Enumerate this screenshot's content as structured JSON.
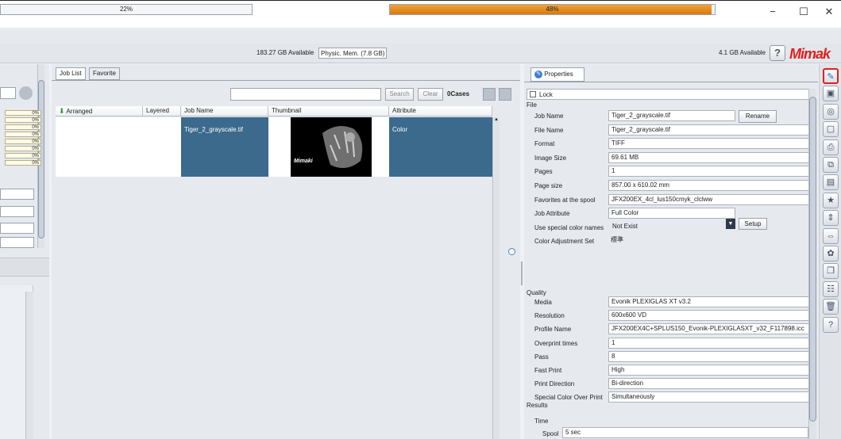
{
  "window": {
    "minimize": "−",
    "maximize": "☐",
    "close": "✕"
  },
  "status": {
    "disk_percent": "22%",
    "disk_available": "183.27 GB Available",
    "mem_label": "Physic. Mem. (7.8 GB)",
    "mem_percent": "48%",
    "mem_fill": 0.99,
    "mem_available": "4.1 GB Available",
    "help": "?",
    "logo": "Mimak"
  },
  "left_panel": {
    "percents": [
      "0%",
      "0%",
      "0%",
      "0%",
      "0%",
      "0%",
      "0%",
      "0%"
    ]
  },
  "job_list": {
    "tabs": [
      "Job List",
      "Favorite"
    ],
    "search_value": "",
    "search_button": "Search",
    "clear_button": "Clear",
    "cases": "0Cases",
    "columns": [
      "Arranged",
      "Layered",
      "Job Name",
      "Thumbnail",
      "Attribute"
    ],
    "rows": [
      {
        "arranged": "",
        "layered": "",
        "job_name": "Tiger_2_grayscale.tif",
        "attribute": "Color",
        "thumb_logo": "Mimaki"
      }
    ]
  },
  "properties": {
    "tab": "Properties",
    "lock": "Lock",
    "file_section": "File",
    "file_rows": [
      {
        "label": "Job Name",
        "value": "Tiger_2_grayscale.tif"
      },
      {
        "label": "File Name",
        "value": "Tiger_2_grayscale.tif"
      },
      {
        "label": "Format",
        "value": "TIFF"
      },
      {
        "label": "Image Size",
        "value": "69.61 MB"
      },
      {
        "label": "Pages",
        "value": "1"
      },
      {
        "label": "Page size",
        "value": "857.00 x 610.02 mm"
      },
      {
        "label": "Favorites at the spool",
        "value": "JFX200EX_4cl_lus150cmyk_clclww"
      },
      {
        "label": "Job Attribute",
        "value": "Full Color"
      },
      {
        "label": "Use special color names",
        "value": "Not Exist"
      },
      {
        "label": "Color Adjustment Set",
        "value": "標準"
      }
    ],
    "rename_button": "Rename",
    "setup_button": "Setup",
    "quality_section": "Quality",
    "quality_rows": [
      {
        "label": "Media",
        "value": "Evonik PLEXIGLAS XT v3.2"
      },
      {
        "label": "Resolution",
        "value": "600x600 VD"
      },
      {
        "label": "Profile Name",
        "value": "JFX200EX4C+SPLUS150_Evonik-PLEXIGLASXT_v32_F117898.icc"
      },
      {
        "label": "Overprint times",
        "value": "1"
      },
      {
        "label": "Pass",
        "value": "8"
      },
      {
        "label": "Fast Print",
        "value": "High"
      },
      {
        "label": "Print Direction",
        "value": "Bi-direction"
      },
      {
        "label": "Special Color Over Print",
        "value": "Simultaneously"
      }
    ],
    "results_section": "Results",
    "time_label": "Time",
    "spool_label": "Spool",
    "spool_value": "5 sec"
  },
  "toolbar_icons": [
    "properties-icon",
    "add-job-icon",
    "color-icon",
    "layout-icon",
    "print-icon",
    "copy-icon",
    "frame-icon",
    "favorite-icon",
    "move-icon",
    "arrange-icon",
    "palette-icon",
    "duplicate-icon",
    "split-icon",
    "trash-icon",
    "help-icon"
  ],
  "toolbar_glyphs": [
    "✎",
    "▣",
    "◎",
    "▢",
    "⎙",
    "⧉",
    "▤",
    "★",
    "⇕",
    "⇔",
    "✿",
    "❐",
    "☷",
    "🗑",
    "?"
  ]
}
